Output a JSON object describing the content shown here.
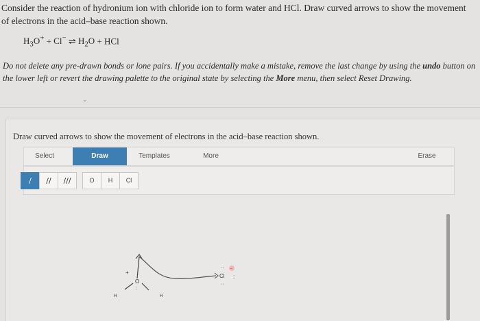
{
  "question": {
    "text": "Consider the reaction of hydronium ion with chloride ion to form water and HCl. Draw curved arrows to show the movement of electrons in the acid–base reaction shown."
  },
  "equation": {
    "lhs1": "H",
    "lhs1_sub": "3",
    "lhs1_rest": "O",
    "lhs1_sup": "+",
    "plus1": " + ",
    "lhs2": "Cl",
    "lhs2_sup": "−",
    "arrow": " ⇌ ",
    "rhs1": "H",
    "rhs1_sub": "2",
    "rhs1_rest": "O",
    "plus2": " + ",
    "rhs2": "HCl"
  },
  "instructions": {
    "part1": "Do not delete any pre-drawn bonds or lone pairs. If you accidentally make a mistake, remove the last change by using the ",
    "undo": "undo",
    "part2": " button on the lower left or revert the drawing palette to the original state by selecting the ",
    "more": "More",
    "part3": " menu, then select Reset Drawing."
  },
  "panel": {
    "title": "Draw curved arrows to show the movement of electrons in the acid–base reaction shown."
  },
  "toolbar": {
    "select": "Select",
    "draw": "Draw",
    "templates": "Templates",
    "more": "More",
    "erase": "Erase"
  },
  "palette": {
    "bonds": [
      "/",
      "//",
      "///"
    ],
    "atoms": [
      "O",
      "H",
      "Cl"
    ]
  },
  "molecule": {
    "oxygen": "O",
    "h_left": "H",
    "h_right": "H",
    "chlorine": "Cl",
    "charge_plus": "+",
    "charge_minus": "−"
  },
  "colors": {
    "accent": "#3d7fb3",
    "background": "#e4e3e1"
  }
}
